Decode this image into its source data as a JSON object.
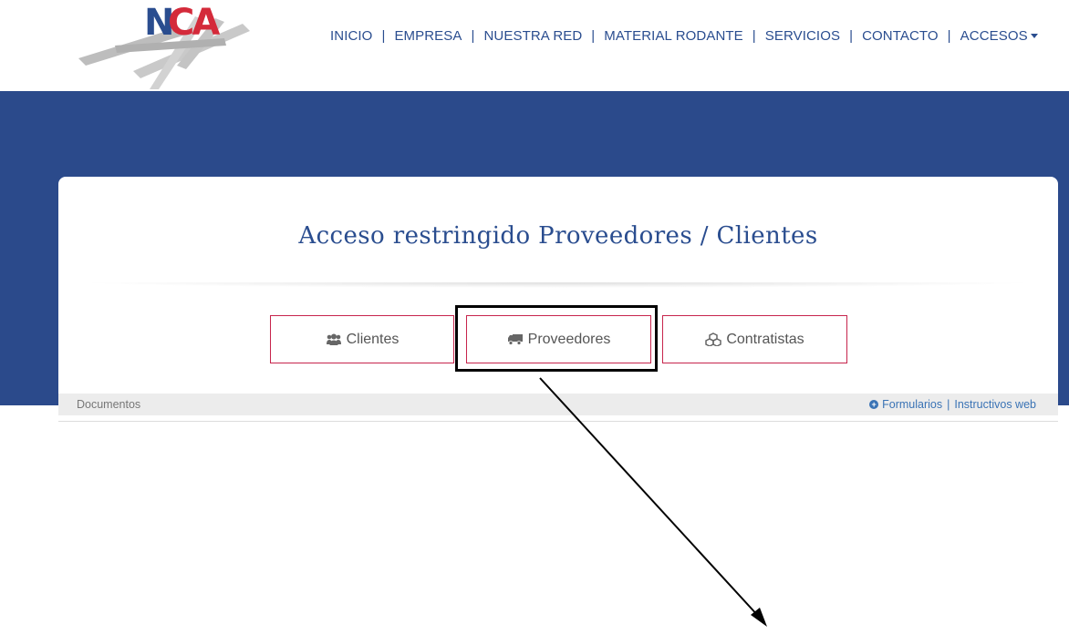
{
  "header": {
    "logo_text": "NCA",
    "nav": [
      {
        "label": "INICIO"
      },
      {
        "label": "EMPRESA"
      },
      {
        "label": "NUESTRA RED"
      },
      {
        "label": "MATERIAL RODANTE"
      },
      {
        "label": "SERVICIOS"
      },
      {
        "label": "CONTACTO"
      },
      {
        "label": "ACCESOS",
        "has_dropdown": true
      }
    ],
    "separator": "|"
  },
  "colors": {
    "brand_blue": "#2b4a8b",
    "logo_red": "#d42a3a",
    "button_border": "#c7244c",
    "link_blue": "#3a73b5"
  },
  "main": {
    "title": "Acceso restringido Proveedores / Clientes",
    "buttons": [
      {
        "label": "Clientes",
        "icon": "users-icon"
      },
      {
        "label": "Proveedores",
        "icon": "truck-icon"
      },
      {
        "label": "Contratistas",
        "icon": "cubes-icon"
      }
    ],
    "documents_bar": {
      "label": "Documentos",
      "links": [
        {
          "label": "Formularios",
          "icon": "plus-circle-icon"
        },
        {
          "label": "Instructivos web"
        }
      ],
      "separator": "|"
    }
  },
  "annotation": {
    "highlighted_button": "Proveedores",
    "arrow": true
  }
}
